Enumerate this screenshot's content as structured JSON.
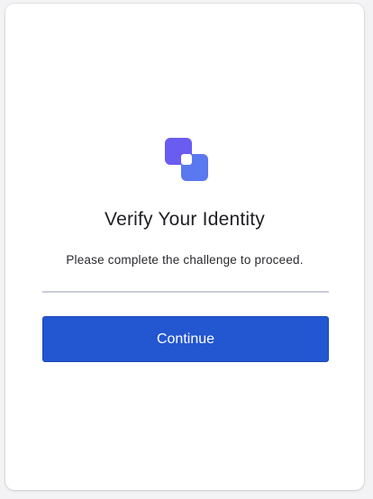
{
  "verify": {
    "logo_icon": "overlapping-squares-icon",
    "title": "Verify Your Identity",
    "subtitle": "Please complete the challenge to proceed.",
    "continue_label": "Continue"
  },
  "colors": {
    "accent": "#2356d1",
    "logo_front": "#5a78f0",
    "logo_back": "#6a5cf0",
    "divider": "#c9cbd6"
  }
}
